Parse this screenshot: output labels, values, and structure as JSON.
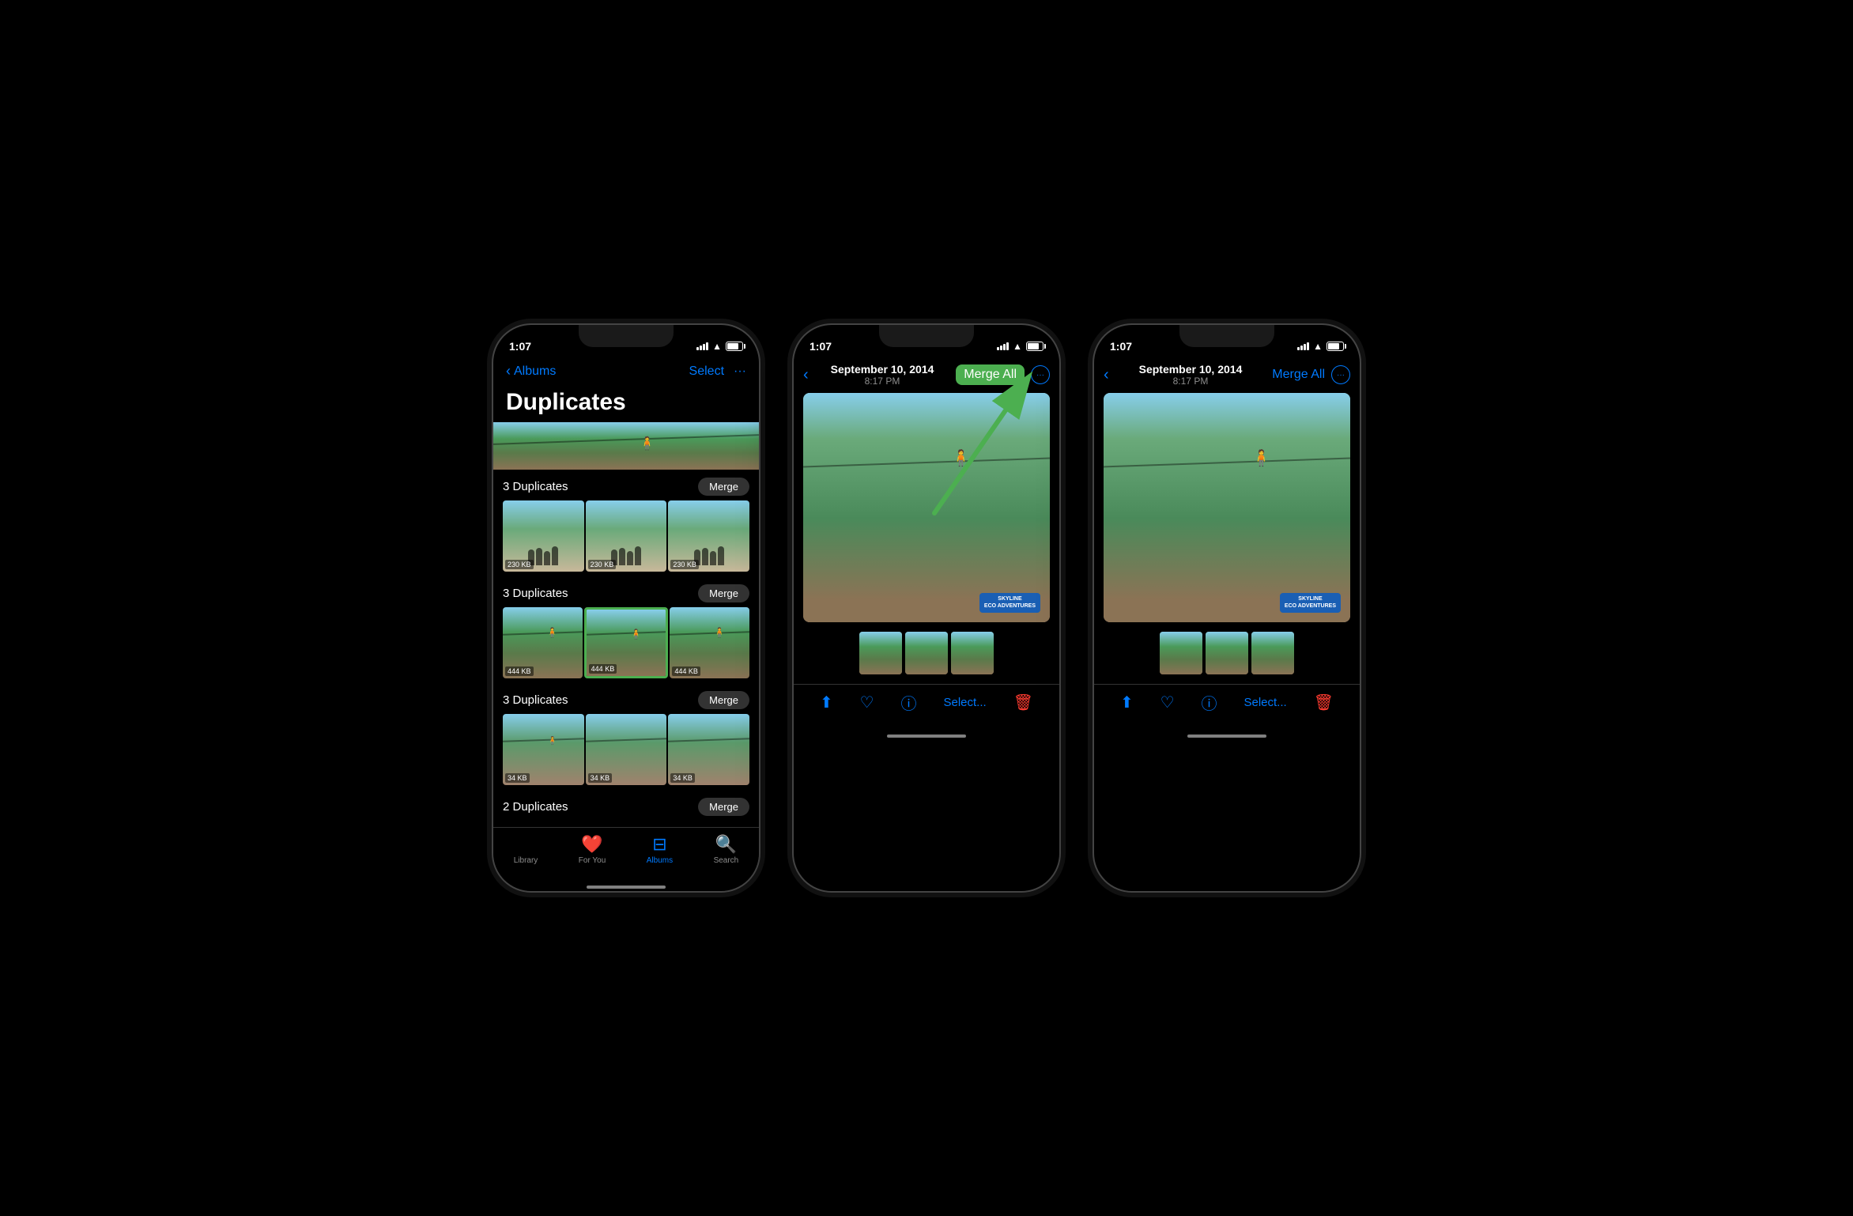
{
  "phone1": {
    "statusBar": {
      "time": "1:07",
      "signal": "signal",
      "wifi": "wifi",
      "battery": "battery"
    },
    "navBack": "Albums",
    "navSelect": "Select",
    "navMore": "···",
    "pageTitle": "Duplicates",
    "groups": [
      {
        "id": "group1",
        "label": "3 Duplicates",
        "mergeBtn": "Merge",
        "photos": [
          {
            "size": "230 KB",
            "type": "people"
          },
          {
            "size": "230 KB",
            "type": "people"
          },
          {
            "size": "230 KB",
            "type": "people"
          }
        ]
      },
      {
        "id": "group2",
        "label": "3 Duplicates",
        "mergeBtn": "Merge",
        "photos": [
          {
            "size": "444 KB",
            "type": "zipline"
          },
          {
            "size": "444 KB",
            "type": "zipline",
            "highlighted": true
          },
          {
            "size": "444 KB",
            "type": "zipline"
          }
        ]
      },
      {
        "id": "group3",
        "label": "3 Duplicates",
        "mergeBtn": "Merge",
        "photos": [
          {
            "size": "34 KB",
            "type": "zipline2"
          },
          {
            "size": "34 KB",
            "type": "zipline2"
          },
          {
            "size": "34 KB",
            "type": "zipline2"
          }
        ]
      },
      {
        "id": "group4",
        "label": "2 Duplicates",
        "mergeBtn": "Merge",
        "photos": []
      }
    ],
    "tabBar": [
      {
        "label": "Library",
        "icon": "📷",
        "active": false
      },
      {
        "label": "For You",
        "icon": "❤️",
        "active": false
      },
      {
        "label": "Albums",
        "icon": "📁",
        "active": true
      },
      {
        "label": "Search",
        "icon": "🔍",
        "active": false
      }
    ]
  },
  "phone2": {
    "statusBar": {
      "time": "1:07"
    },
    "navDate": "September 10, 2014",
    "navTime": "8:17 PM",
    "mergeAllBtn": "Merge All",
    "mergeAllHighlighted": true,
    "moreIcon": "···",
    "mainPhoto": "zipline",
    "skylineLogo": "SKYLINE\nECO ADVENTURES",
    "thumbs": [
      {
        "type": "zipline",
        "selected": false
      },
      {
        "type": "zipline",
        "selected": false
      },
      {
        "type": "zipline",
        "selected": false
      }
    ],
    "actionBar": {
      "share": "share",
      "heart": "heart",
      "info": "info",
      "select": "Select...",
      "trash": "trash"
    }
  },
  "phone3": {
    "statusBar": {
      "time": "1:07"
    },
    "navDate": "September 10, 2014",
    "navTime": "8:17 PM",
    "mergeAllBtn": "Merge All",
    "mergeAllHighlighted": false,
    "moreIcon": "···",
    "mainPhoto": "zipline",
    "skylineLogo": "SKYLINE\nECO ADVENTURES",
    "thumbs": [
      {
        "type": "zipline",
        "selected": false
      },
      {
        "type": "zipline",
        "selected": false
      },
      {
        "type": "zipline",
        "selected": false
      }
    ],
    "actionBar": {
      "share": "share",
      "heart": "heart",
      "info": "info",
      "select": "Select...",
      "trash": "trash"
    }
  }
}
